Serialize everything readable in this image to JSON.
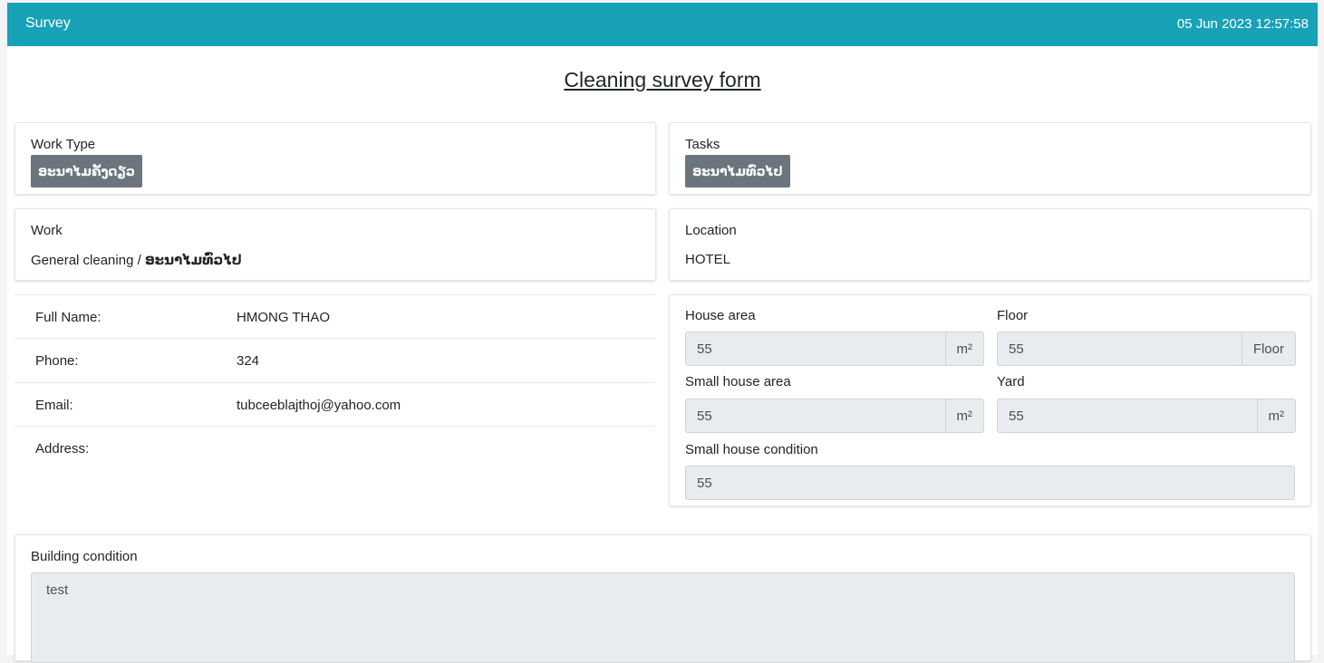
{
  "header": {
    "title": "Survey",
    "datetime": "05 Jun 2023 12:57:58"
  },
  "form_title": "Cleaning survey form",
  "work_type": {
    "label": "Work Type",
    "badge": "ອະນາໄມຄັ້ງດຽວ"
  },
  "tasks": {
    "label": "Tasks",
    "badge": "ອະນາໄມທົ່ວໄປ"
  },
  "work": {
    "label": "Work",
    "value_en": "General cleaning / ",
    "value_lo": "ອະນາໄມທົ່ວໄປ"
  },
  "location": {
    "label": "Location",
    "value": "HOTEL"
  },
  "customer": {
    "rows": [
      {
        "key": "Full Name:",
        "value": "HMONG THAO"
      },
      {
        "key": "Phone:",
        "value": "324"
      },
      {
        "key": "Email:",
        "value": "tubceeblajthoj@yahoo.com"
      },
      {
        "key": "Address:",
        "value": ""
      }
    ]
  },
  "measurements": {
    "house_area": {
      "label": "House area",
      "value": "55",
      "unit": "m²"
    },
    "floor": {
      "label": "Floor",
      "value": "55",
      "unit": "Floor"
    },
    "small_house_area": {
      "label": "Small house area",
      "value": "55",
      "unit": "m²"
    },
    "yard": {
      "label": "Yard",
      "value": "55",
      "unit": "m²"
    },
    "small_house_condition": {
      "label": "Small house condition",
      "value": "55"
    }
  },
  "building_condition": {
    "label": "Building condition",
    "value": "test"
  },
  "colors": {
    "header_bg": "#17a2b8",
    "badge_bg": "#6c757d",
    "input_bg": "#e9ecef"
  }
}
